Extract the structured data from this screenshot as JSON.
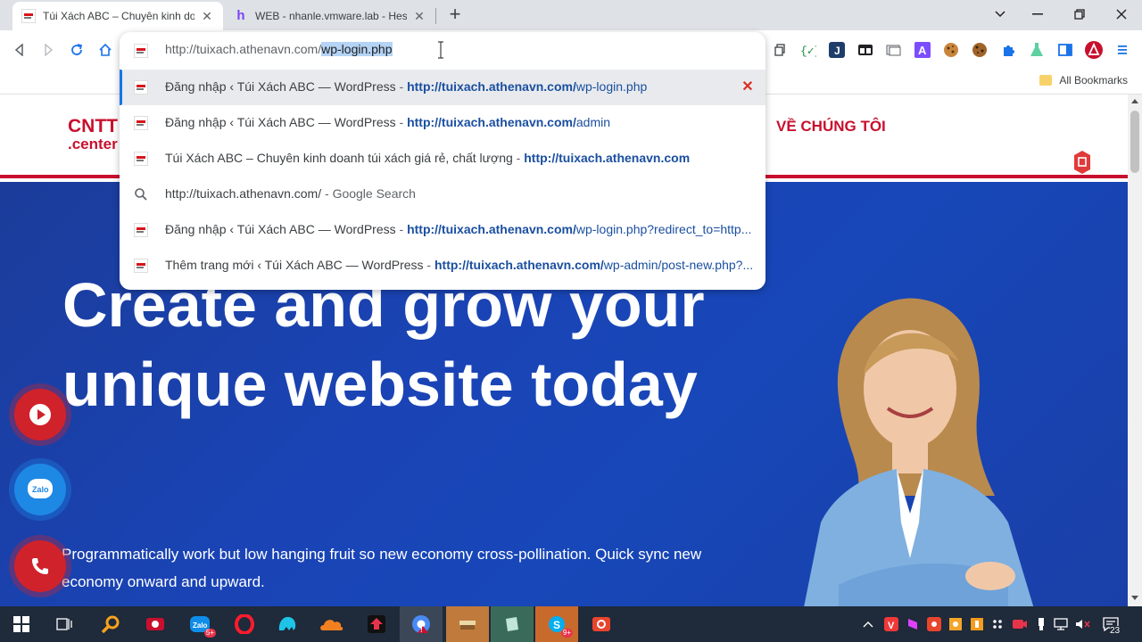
{
  "tabs": [
    {
      "title": "Túi Xách ABC – Chuyên kinh doanh túi xách giá rẻ, chất lượng",
      "favicon": "cntt-favicon",
      "active": true
    },
    {
      "title": "WEB - nhanle.vmware.lab - Hestia",
      "favicon": "hestia-favicon",
      "active": false
    }
  ],
  "omnibox": {
    "url_prefix": "http://tuixach.athenavn.com/",
    "url_selected": "wp-login.php",
    "suggestions": [
      {
        "title": "Đăng nhập ‹ Túi Xách ABC — WordPress",
        "sep": "-",
        "url_bold": "http://tuixach.athenavn.com/",
        "url_rest": "wp-login.php",
        "icon": "cntt-favicon",
        "highlighted": true
      },
      {
        "title": "Đăng nhập ‹ Túi Xách ABC — WordPress",
        "sep": "-",
        "url_bold": "http://tuixach.athenavn.com/",
        "url_rest": "admin",
        "icon": "cntt-favicon",
        "highlighted": false
      },
      {
        "title": "Túi Xách ABC – Chuyên kinh doanh túi xách giá rẻ, chất lượng",
        "sep": "-",
        "url_bold": "http://tuixach.athenavn.com",
        "url_rest": "",
        "icon": "cntt-favicon",
        "highlighted": false
      },
      {
        "title": "http://tuixach.athenavn.com/",
        "sep": "-",
        "search_label": "Google Search",
        "icon": "search-icon",
        "highlighted": false
      },
      {
        "title": "Đăng nhập ‹ Túi Xách ABC — WordPress",
        "sep": "-",
        "url_bold": "http://tuixach.athenavn.com/",
        "url_rest": "wp-login.php?redirect_to=http...",
        "icon": "cntt-favicon",
        "highlighted": false
      },
      {
        "title": "Thêm trang mới ‹ Túi Xách ABC — WordPress",
        "sep": "-",
        "url_bold": "http://tuixach.athenavn.com/",
        "url_rest": "wp-admin/post-new.php?...",
        "icon": "cntt-favicon",
        "highlighted": false
      }
    ]
  },
  "bookmarks": {
    "all_label": "All Bookmarks"
  },
  "site": {
    "logo_top": "CNTT",
    "logo_bottom": ".center",
    "nav_about": "VỀ CHÚNG TÔI",
    "hero_title_line1": "Create and grow your",
    "hero_title_line2": "unique website today",
    "hero_text": "Programmatically work but low hanging fruit so new economy cross-pollination. Quick sync new economy onward and upward."
  },
  "float_buttons": {
    "zalo_label": "Zalo"
  },
  "taskbar": {
    "zalo_badge": "5+",
    "skype_badge": "9+",
    "notification_count": "23"
  },
  "colors": {
    "brand_red": "#c8102e",
    "hero_blue": "#1a44b6",
    "link_blue": "#1a4fa0",
    "selection": "#b4d3f5"
  }
}
